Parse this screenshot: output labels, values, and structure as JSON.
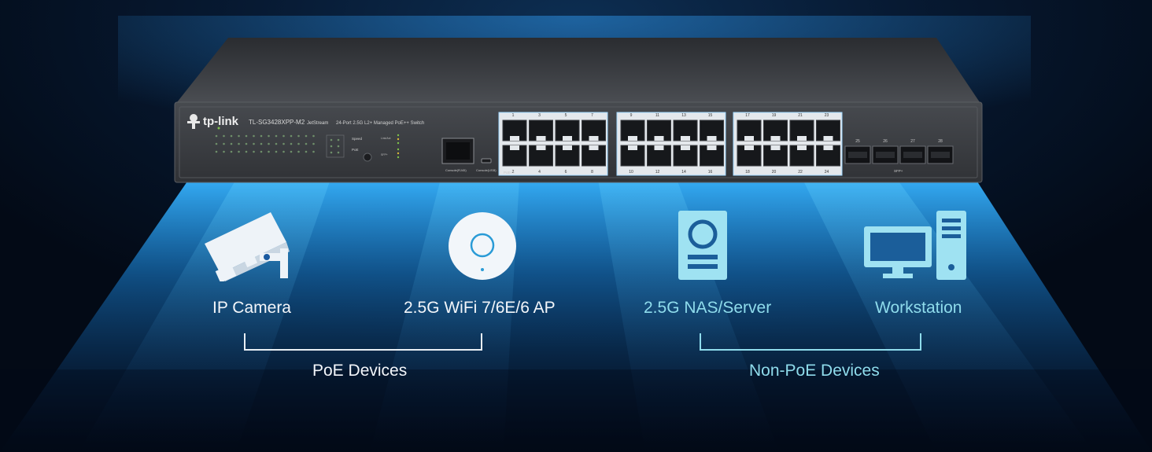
{
  "switch": {
    "brand": "tp-link",
    "model": "TL-SG3428XPP-M2",
    "series": "JetStream",
    "description": "24-Port 2.5G L2+ Managed PoE++ Switch",
    "port_numbers_top": [
      "1",
      "3",
      "5",
      "7",
      "9",
      "11",
      "13",
      "15",
      "17",
      "19",
      "21",
      "23"
    ],
    "port_numbers_bottom": [
      "2",
      "4",
      "6",
      "8",
      "10",
      "12",
      "14",
      "16",
      "18",
      "20",
      "22",
      "24"
    ],
    "sfp_numbers": [
      "25",
      "26",
      "27",
      "28"
    ],
    "console_rj45_label": "Console(RJ45)",
    "console_usb_label": "Console(USB)",
    "poe_label": "PoE++",
    "sfp_label": "SFP+",
    "speed_label": "Speed",
    "poe_button_label": "PoE"
  },
  "devices": [
    {
      "name": "IP Camera",
      "icon": "security-camera-icon",
      "group": "poe"
    },
    {
      "name": "2.5G WiFi 7/6E/6 AP",
      "icon": "access-point-icon",
      "group": "poe"
    },
    {
      "name": "2.5G NAS/Server",
      "icon": "nas-server-icon",
      "group": "non-poe"
    },
    {
      "name": "Workstation",
      "icon": "workstation-icon",
      "group": "non-poe"
    }
  ],
  "groups": {
    "poe": "PoE Devices",
    "non_poe": "Non-PoE Devices"
  },
  "colors": {
    "poe_text": "#f3f6fa",
    "non_poe_text": "#8fdcec",
    "light_beam": "#1b8fe0",
    "chassis": "#3a3d42"
  }
}
